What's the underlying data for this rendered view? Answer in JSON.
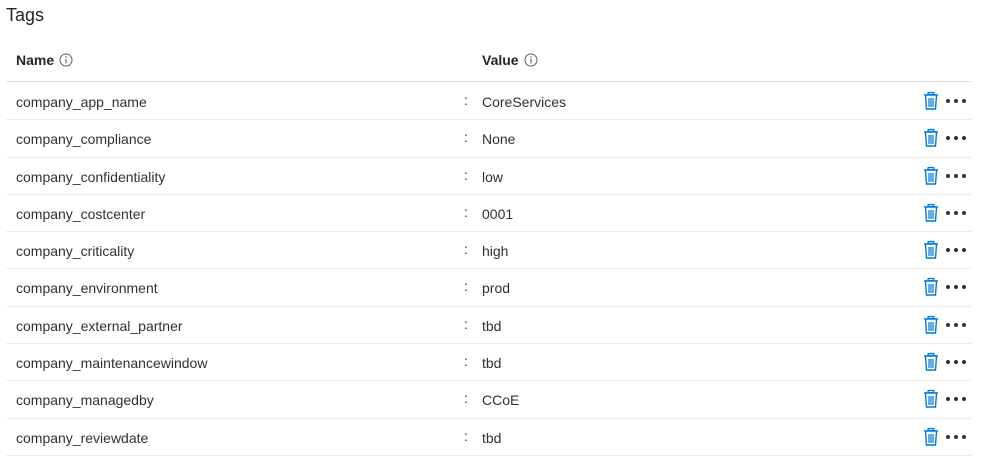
{
  "page": {
    "title": "Tags"
  },
  "table": {
    "headers": {
      "name": "Name",
      "value": "Value"
    },
    "separator": ":",
    "rows": [
      {
        "name": "company_app_name",
        "value": "CoreServices"
      },
      {
        "name": "company_compliance",
        "value": "None"
      },
      {
        "name": "company_confidentiality",
        "value": "low"
      },
      {
        "name": "company_costcenter",
        "value": "0001"
      },
      {
        "name": "company_criticality",
        "value": "high"
      },
      {
        "name": "company_environment",
        "value": "prod"
      },
      {
        "name": "company_external_partner",
        "value": "tbd"
      },
      {
        "name": "company_maintenancewindow",
        "value": "tbd"
      },
      {
        "name": "company_managedby",
        "value": "CCoE"
      },
      {
        "name": "company_reviewdate",
        "value": "tbd"
      }
    ]
  },
  "icons": {
    "info": "info-icon",
    "delete": "trash-icon",
    "more": "more-horizontal-icon"
  },
  "colors": {
    "delete_icon": "#0078d4",
    "more_icon": "#323130",
    "row_border": "#edebe9"
  }
}
